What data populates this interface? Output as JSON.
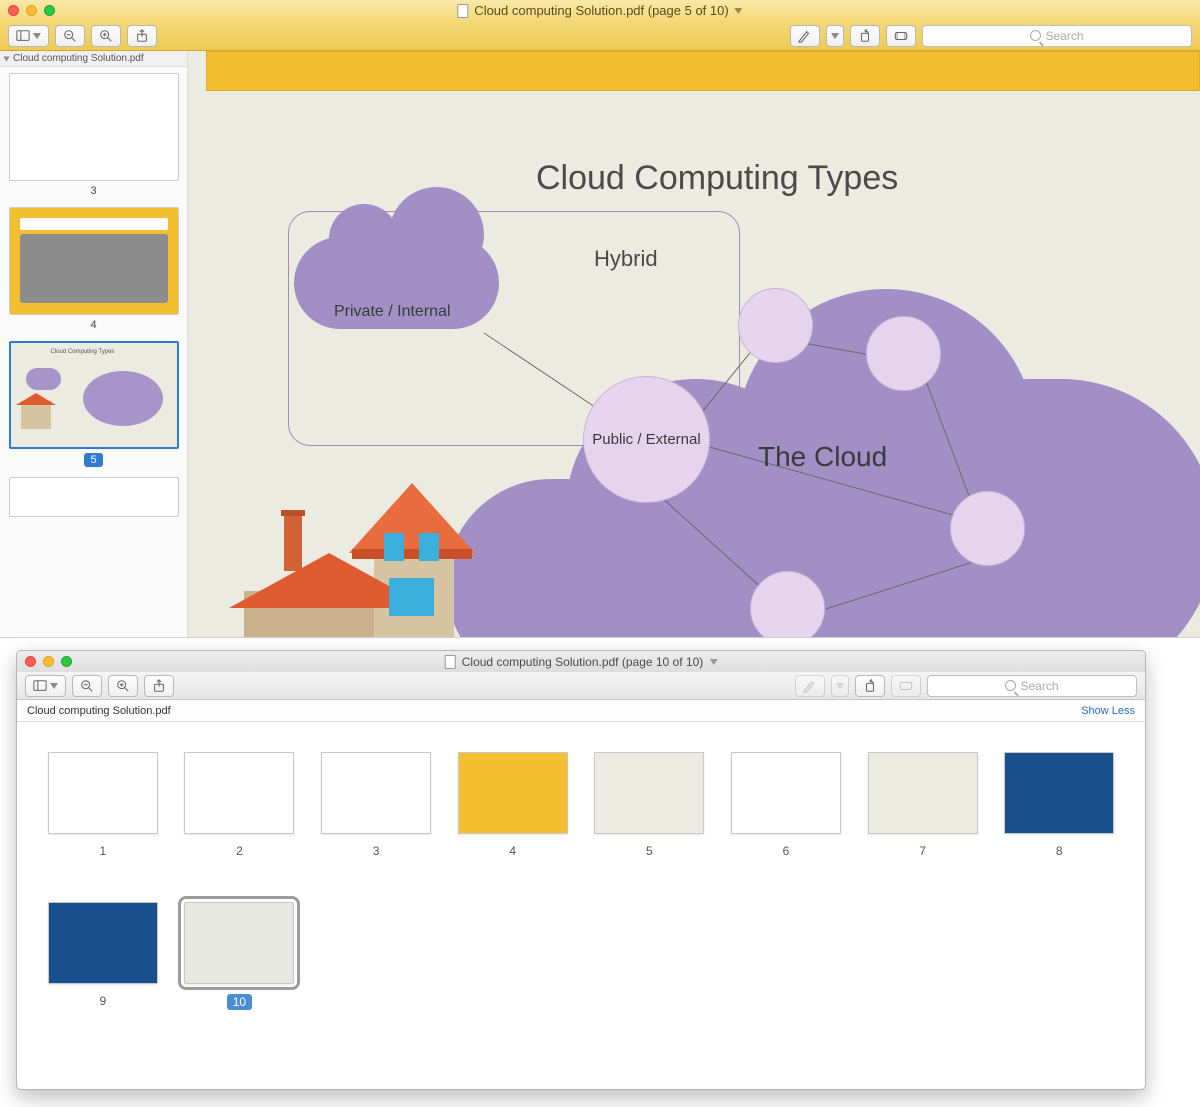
{
  "win1": {
    "title": "Cloud computing Solution.pdf (page 5 of 10)",
    "search_placeholder": "Search",
    "sidebar_title": "Cloud computing Solution.pdf",
    "thumbs": [
      {
        "num": "3",
        "sel": false
      },
      {
        "num": "4",
        "sel": false
      },
      {
        "num": "5",
        "sel": true
      }
    ]
  },
  "diagram": {
    "title": "Cloud Computing Types",
    "hybrid_label": "Hybrid",
    "private_label": "Private / Internal",
    "public_label": "Public / External",
    "cloud_label": "The Cloud"
  },
  "win2": {
    "title": "Cloud computing Solution.pdf (page 10 of 10)",
    "search_placeholder": "Search",
    "head_title": "Cloud computing Solution.pdf",
    "showless": "Show Less",
    "thumbs": [
      {
        "num": "1",
        "sel": false,
        "cls": "g1"
      },
      {
        "num": "2",
        "sel": false,
        "cls": "g2"
      },
      {
        "num": "3",
        "sel": false,
        "cls": "g3"
      },
      {
        "num": "4",
        "sel": false,
        "cls": "g4"
      },
      {
        "num": "5",
        "sel": false,
        "cls": "g5"
      },
      {
        "num": "6",
        "sel": false,
        "cls": "g6"
      },
      {
        "num": "7",
        "sel": false,
        "cls": "g7"
      },
      {
        "num": "8",
        "sel": false,
        "cls": "g8"
      },
      {
        "num": "9",
        "sel": false,
        "cls": "g9"
      },
      {
        "num": "10",
        "sel": true,
        "cls": "g10"
      }
    ]
  }
}
